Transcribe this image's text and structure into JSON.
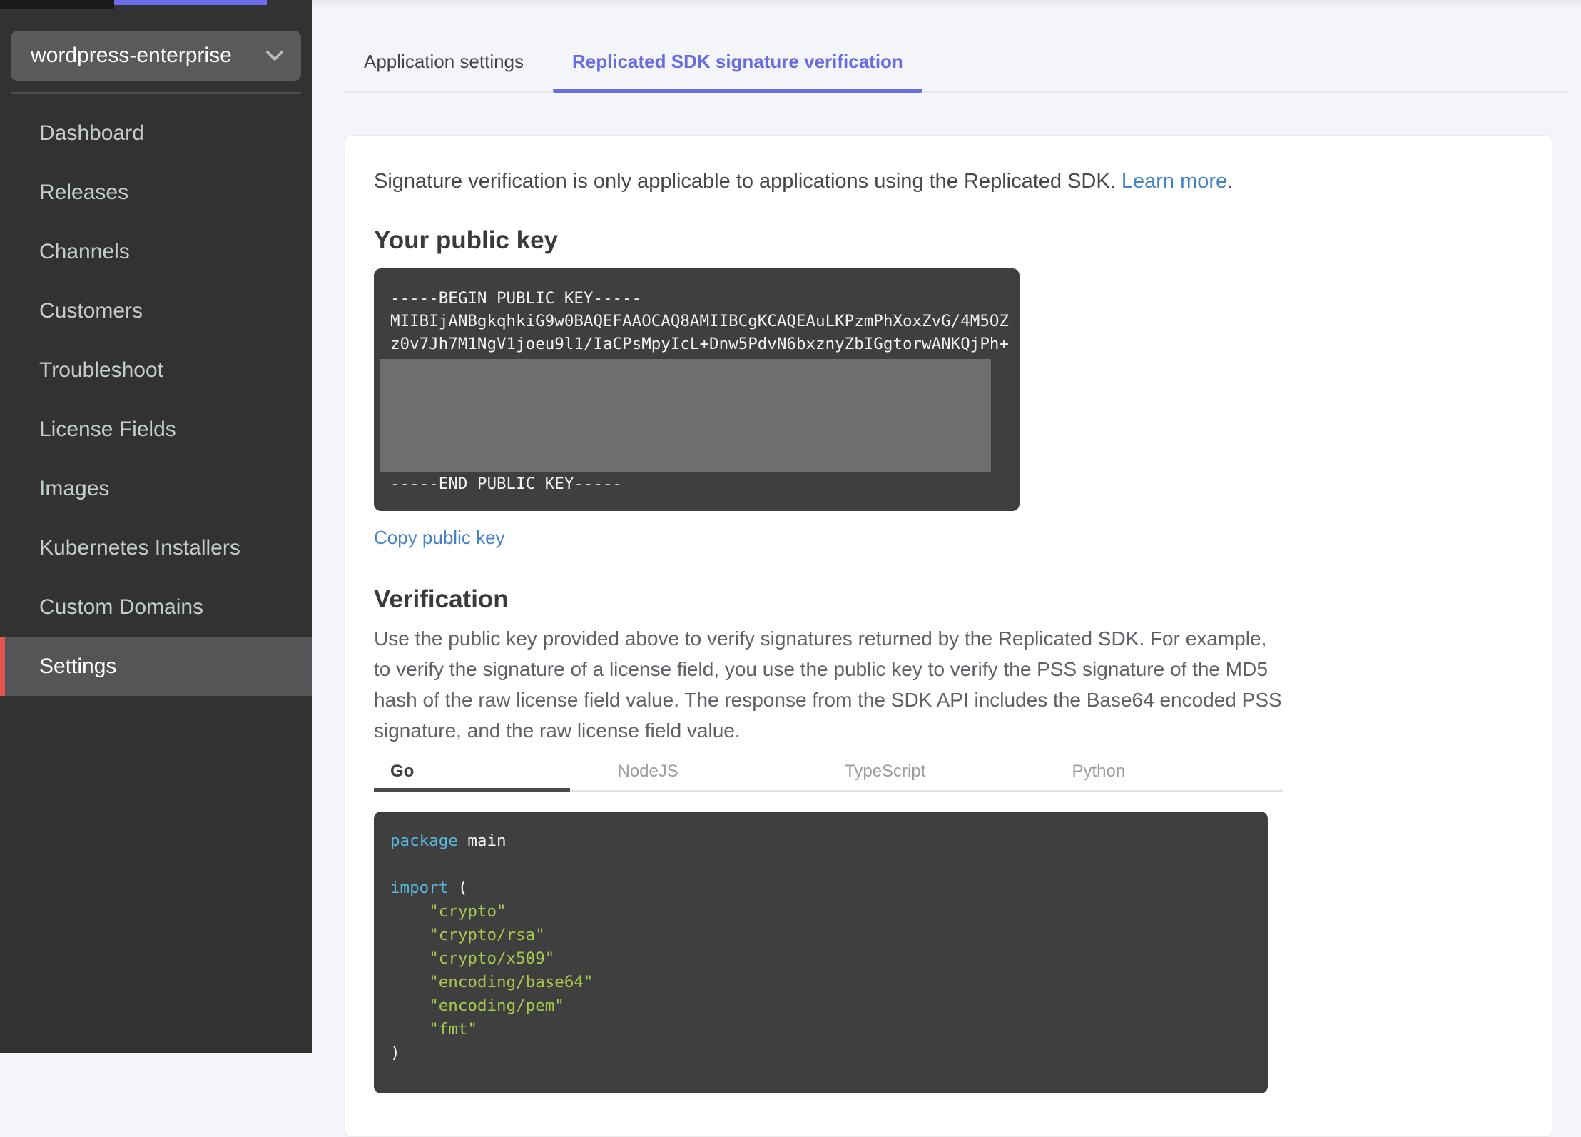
{
  "topbar": {
    "accent_color": "#6a6cec"
  },
  "sidebar": {
    "app_selector": {
      "label": "wordpress-enterprise"
    },
    "items": [
      {
        "label": "Dashboard",
        "active": false
      },
      {
        "label": "Releases",
        "active": false
      },
      {
        "label": "Channels",
        "active": false
      },
      {
        "label": "Customers",
        "active": false
      },
      {
        "label": "Troubleshoot",
        "active": false
      },
      {
        "label": "License Fields",
        "active": false
      },
      {
        "label": "Images",
        "active": false
      },
      {
        "label": "Kubernetes Installers",
        "active": false
      },
      {
        "label": "Custom Domains",
        "active": false
      },
      {
        "label": "Settings",
        "active": true
      }
    ],
    "active_accent_color": "#e5544f"
  },
  "tabs": [
    {
      "label": "Application settings",
      "active": false
    },
    {
      "label": "Replicated SDK signature verification",
      "active": true
    }
  ],
  "tab_accent_color": "#696ce0",
  "content": {
    "intro": {
      "text": "Signature verification is only applicable to applications using the Replicated SDK.",
      "link_label": "Learn more",
      "suffix": "."
    },
    "public_key": {
      "heading": "Your public key",
      "begin_line": "-----BEGIN PUBLIC KEY-----",
      "visible_lines": [
        "MIIBIjANBgkqhkiG9w0BAQEFAAOCAQ8AMIIBCgKCAQEAuLKPzmPhXoxZvG/4M5OZ",
        "z0v7Jh7M1NgV1joeu9l1/IaCPsMpyIcL+Dnw5PdvN6bxznyZbIGgtorwANKQjPh+"
      ],
      "end_line": "-----END PUBLIC KEY-----",
      "copy_label": "Copy public key"
    },
    "verification": {
      "heading": "Verification",
      "paragraph": "Use the public key provided above to verify signatures returned by the Replicated SDK. For example, to verify the signature of a license field, you use the public key to verify the PSS signature of the MD5 hash of the raw license field value. The response from the SDK API includes the Base64 encoded PSS signature, and the raw license field value.",
      "languages": [
        {
          "label": "Go",
          "active": true
        },
        {
          "label": "NodeJS",
          "active": false
        },
        {
          "label": "TypeScript",
          "active": false
        },
        {
          "label": "Python",
          "active": false
        }
      ],
      "code_lines": [
        [
          {
            "t": "package",
            "c": "kw"
          },
          {
            "t": " main",
            "c": "pl"
          }
        ],
        [],
        [
          {
            "t": "import",
            "c": "kw"
          },
          {
            "t": " (",
            "c": "pl"
          }
        ],
        [
          {
            "t": "    ",
            "c": "pl"
          },
          {
            "t": "\"crypto\"",
            "c": "str"
          }
        ],
        [
          {
            "t": "    ",
            "c": "pl"
          },
          {
            "t": "\"crypto/rsa\"",
            "c": "str"
          }
        ],
        [
          {
            "t": "    ",
            "c": "pl"
          },
          {
            "t": "\"crypto/x509\"",
            "c": "str"
          }
        ],
        [
          {
            "t": "    ",
            "c": "pl"
          },
          {
            "t": "\"encoding/base64\"",
            "c": "str"
          }
        ],
        [
          {
            "t": "    ",
            "c": "pl"
          },
          {
            "t": "\"encoding/pem\"",
            "c": "str"
          }
        ],
        [
          {
            "t": "    ",
            "c": "pl"
          },
          {
            "t": "\"fmt\"",
            "c": "str"
          }
        ],
        [
          {
            "t": ")",
            "c": "pl"
          }
        ]
      ],
      "code_colors": {
        "keyword": "#57b8de",
        "string": "#a9c84d",
        "plain": "#fbfbfb"
      }
    }
  }
}
